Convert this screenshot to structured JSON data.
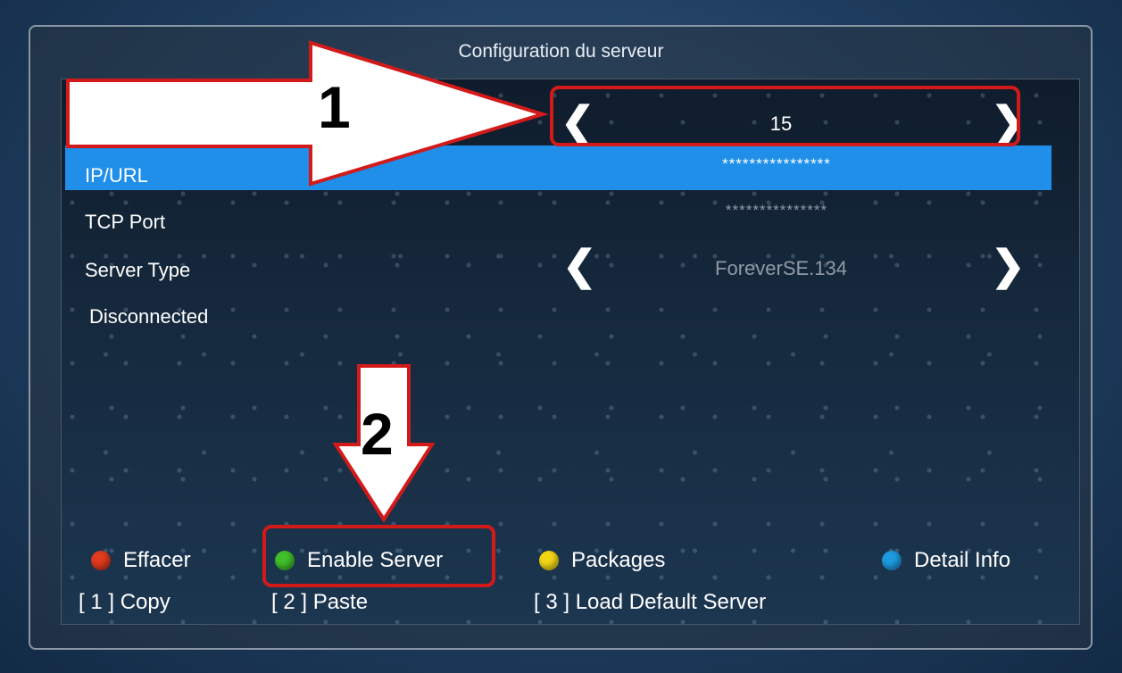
{
  "window": {
    "title": "Configuration du serveur"
  },
  "selector": {
    "value": "15"
  },
  "rows": [
    {
      "label": "IP/URL",
      "value": "****************"
    },
    {
      "label": "TCP Port",
      "value": "***************"
    },
    {
      "label": "Server Type",
      "value": "ForeverSE.134"
    },
    {
      "label": "Disconnected"
    }
  ],
  "legend": [
    {
      "label": "Effacer",
      "color": "#e23a1e"
    },
    {
      "label": "Enable Server",
      "color": "#3fbf2a"
    },
    {
      "label": "Packages",
      "color": "#f2d614"
    },
    {
      "label": "Detail Info",
      "color": "#1e9be0"
    }
  ],
  "keys": [
    {
      "label": "[ 1 ] Copy"
    },
    {
      "label": "[ 2 ] Paste"
    },
    {
      "label": "[ 3 ] Load Default Server"
    }
  ],
  "annotations": [
    {
      "number": "1"
    },
    {
      "number": "2"
    }
  ],
  "colors": {
    "highlight": "#1f8fea",
    "callout": "#d31a1a"
  }
}
